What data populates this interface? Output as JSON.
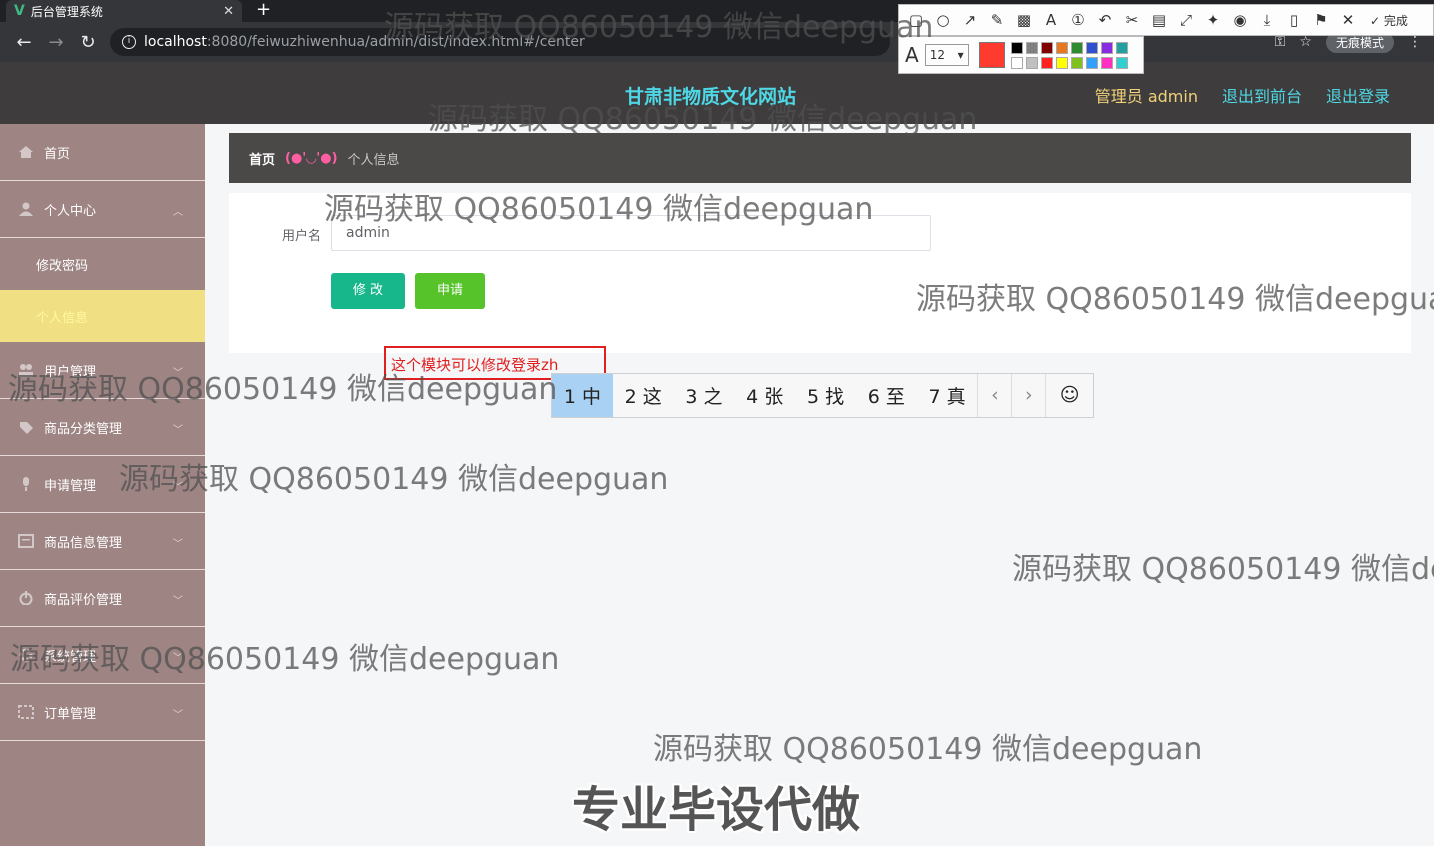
{
  "browser": {
    "tab_title": "后台管理系统",
    "new_tab": "+",
    "tab_close": "✕",
    "url_host": "localhost",
    "url_path": ":8080/feiwuzhiwenhua/admin/dist/index.html#/center",
    "incognito_label": "无痕模式"
  },
  "snip_tool": {
    "done_label": "完成",
    "font_size": "12",
    "current_color": "#ff3b30",
    "palette": [
      "#000000",
      "#808080",
      "#800000",
      "#e87820",
      "#2e8b2e",
      "#3050d0",
      "#8a2be2",
      "#20a0a0",
      "#ffffff",
      "#c0c0c0",
      "#ff2020",
      "#ffff00",
      "#80c020",
      "#30a0ff",
      "#ff30c0",
      "#30d0d0"
    ]
  },
  "header": {
    "site_title": "甘肃非物质文化网站",
    "admin_label": "管理员 admin",
    "to_front": "退出到前台",
    "logout": "退出登录"
  },
  "sidebar": {
    "items": [
      {
        "label": "首页",
        "icon": "home-icon"
      },
      {
        "label": "个人中心",
        "icon": "user-icon"
      },
      {
        "label": "用户管理",
        "icon": "users-icon"
      },
      {
        "label": "商品分类管理",
        "icon": "tag-icon"
      },
      {
        "label": "申请管理",
        "icon": "mic-icon"
      },
      {
        "label": "商品信息管理",
        "icon": "list-icon"
      },
      {
        "label": "商品评价管理",
        "icon": "power-icon"
      },
      {
        "label": "系统管理",
        "icon": "gear-icon"
      },
      {
        "label": "订单管理",
        "icon": "order-icon"
      }
    ],
    "sub_items": [
      {
        "label": "修改密码"
      },
      {
        "label": "个人信息"
      }
    ]
  },
  "breadcrumb": {
    "home": "首页",
    "face": "(●'◡'●)",
    "current": "个人信息"
  },
  "form": {
    "username_label": "用户名",
    "username_value": "admin",
    "edit_button": "修 改",
    "apply_button": "申请"
  },
  "annotation": {
    "text": "这个模块可以修改登录zh"
  },
  "ime": {
    "candidates": [
      "1 中",
      "2 这",
      "3 之",
      "4 张",
      "5 找",
      "6 至",
      "7 真"
    ],
    "prev": "‹",
    "next": "›",
    "emoji": "☺"
  },
  "watermarks": {
    "text": "源码获取 QQ86050149 微信deepguan",
    "big": "专业毕设代做"
  }
}
